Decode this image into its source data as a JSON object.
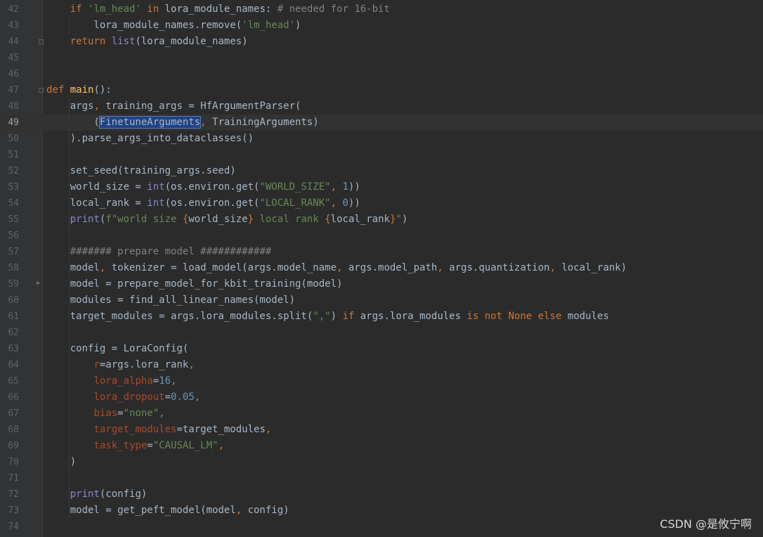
{
  "lines": [
    {
      "n": "42",
      "segs": [
        [
          "    ",
          ""
        ],
        [
          "if ",
          "kw"
        ],
        [
          "'lm_head'",
          "str"
        ],
        [
          " in ",
          "kw"
        ],
        [
          "lora_module_names: ",
          ""
        ],
        [
          "# needed for 16-bit",
          "com"
        ]
      ]
    },
    {
      "n": "43",
      "segs": [
        [
          "        lora_module_names.remove(",
          ""
        ],
        [
          "'lm_head'",
          "str"
        ],
        [
          ")",
          ""
        ]
      ]
    },
    {
      "n": "44",
      "segs": [
        [
          "    ",
          ""
        ],
        [
          "return ",
          "kw"
        ],
        [
          "list",
          "bi"
        ],
        [
          "(lora_module_names)",
          ""
        ]
      ]
    },
    {
      "n": "45",
      "segs": []
    },
    {
      "n": "46",
      "segs": []
    },
    {
      "n": "47",
      "segs": [
        [
          "def ",
          "kw"
        ],
        [
          "main",
          "fn"
        ],
        [
          "():",
          ""
        ]
      ]
    },
    {
      "n": "48",
      "segs": [
        [
          "    args",
          ""
        ],
        [
          ", ",
          "kw"
        ],
        [
          "training_args = HfArgumentParser(",
          ""
        ]
      ]
    },
    {
      "n": "49",
      "current": true,
      "segs": [
        [
          "        (",
          ""
        ],
        [
          "FinetuneArguments",
          "sel"
        ],
        [
          ", ",
          "kw"
        ],
        [
          "TrainingArguments)",
          ""
        ]
      ]
    },
    {
      "n": "50",
      "segs": [
        [
          "    ).parse_args_into_dataclasses()",
          ""
        ]
      ]
    },
    {
      "n": "51",
      "segs": []
    },
    {
      "n": "52",
      "segs": [
        [
          "    set_seed(training_args.seed)",
          ""
        ]
      ]
    },
    {
      "n": "53",
      "segs": [
        [
          "    world_size = ",
          ""
        ],
        [
          "int",
          "bi"
        ],
        [
          "(os.environ.get(",
          ""
        ],
        [
          "\"WORLD_SIZE\"",
          "str"
        ],
        [
          ", ",
          "kw"
        ],
        [
          "1",
          "num"
        ],
        [
          "))",
          ""
        ]
      ]
    },
    {
      "n": "54",
      "segs": [
        [
          "    local_rank = ",
          ""
        ],
        [
          "int",
          "bi"
        ],
        [
          "(os.environ.get(",
          ""
        ],
        [
          "\"LOCAL_RANK\"",
          "str"
        ],
        [
          ", ",
          "kw"
        ],
        [
          "0",
          "num"
        ],
        [
          "))",
          ""
        ]
      ]
    },
    {
      "n": "55",
      "segs": [
        [
          "    ",
          ""
        ],
        [
          "print",
          "bi"
        ],
        [
          "(",
          ""
        ],
        [
          "f\"world size ",
          "str"
        ],
        [
          "{",
          "kw"
        ],
        [
          "world_size",
          ""
        ],
        [
          "}",
          "kw"
        ],
        [
          " local rank ",
          "str"
        ],
        [
          "{",
          "kw"
        ],
        [
          "local_rank",
          ""
        ],
        [
          "}",
          "kw"
        ],
        [
          "\"",
          "str"
        ],
        [
          ")",
          ""
        ]
      ]
    },
    {
      "n": "56",
      "segs": []
    },
    {
      "n": "57",
      "segs": [
        [
          "    ",
          ""
        ],
        [
          "####### prepare model ############",
          "com"
        ]
      ]
    },
    {
      "n": "58",
      "segs": [
        [
          "    model",
          ""
        ],
        [
          ", ",
          "kw"
        ],
        [
          "tokenizer = load_model(args.model_name",
          ""
        ],
        [
          ", ",
          "kw"
        ],
        [
          "args.model_path",
          ""
        ],
        [
          ", ",
          "kw"
        ],
        [
          "args.quantization",
          ""
        ],
        [
          ", ",
          "kw"
        ],
        [
          "local_rank)",
          ""
        ]
      ]
    },
    {
      "n": "59",
      "segs": [
        [
          "    model = prepare_model_for_kbit_training(model)",
          ""
        ]
      ]
    },
    {
      "n": "60",
      "segs": [
        [
          "    modules = find_all_linear_names(model)",
          ""
        ]
      ]
    },
    {
      "n": "61",
      "segs": [
        [
          "    target_modules = args.lora_modules.split(",
          ""
        ],
        [
          "\",\"",
          "str"
        ],
        [
          ") ",
          ""
        ],
        [
          "if ",
          "kw"
        ],
        [
          "args.lora_modules ",
          ""
        ],
        [
          "is not None else ",
          "kw"
        ],
        [
          "modules",
          ""
        ]
      ]
    },
    {
      "n": "62",
      "segs": []
    },
    {
      "n": "63",
      "segs": [
        [
          "    config = LoraConfig(",
          ""
        ]
      ]
    },
    {
      "n": "64",
      "segs": [
        [
          "        ",
          ""
        ],
        [
          "r",
          "param"
        ],
        [
          "=args.lora_rank",
          ""
        ],
        [
          ",",
          "kw"
        ]
      ]
    },
    {
      "n": "65",
      "segs": [
        [
          "        ",
          ""
        ],
        [
          "lora_alpha",
          "param"
        ],
        [
          "=",
          ""
        ],
        [
          "16",
          "num"
        ],
        [
          ",",
          "kw"
        ]
      ]
    },
    {
      "n": "66",
      "segs": [
        [
          "        ",
          ""
        ],
        [
          "lora_dropout",
          "param"
        ],
        [
          "=",
          ""
        ],
        [
          "0.05",
          "num"
        ],
        [
          ",",
          "kw"
        ]
      ]
    },
    {
      "n": "67",
      "segs": [
        [
          "        ",
          ""
        ],
        [
          "bias",
          "param"
        ],
        [
          "=",
          ""
        ],
        [
          "\"none\"",
          "str"
        ],
        [
          ",",
          "kw"
        ]
      ]
    },
    {
      "n": "68",
      "segs": [
        [
          "        ",
          ""
        ],
        [
          "target_modules",
          "param"
        ],
        [
          "=target_modules",
          ""
        ],
        [
          ",",
          "kw"
        ]
      ]
    },
    {
      "n": "69",
      "segs": [
        [
          "        ",
          ""
        ],
        [
          "task_type",
          "param"
        ],
        [
          "=",
          ""
        ],
        [
          "\"CAUSAL_LM\"",
          "str"
        ],
        [
          ",",
          "kw"
        ]
      ]
    },
    {
      "n": "70",
      "segs": [
        [
          "    )",
          ""
        ]
      ]
    },
    {
      "n": "71",
      "segs": []
    },
    {
      "n": "72",
      "segs": [
        [
          "    ",
          ""
        ],
        [
          "print",
          "bi"
        ],
        [
          "(config)",
          ""
        ]
      ]
    },
    {
      "n": "73",
      "segs": [
        [
          "    model = get_peft_model(model",
          ""
        ],
        [
          ", ",
          "kw"
        ],
        [
          "config)",
          ""
        ]
      ]
    },
    {
      "n": "74",
      "segs": []
    }
  ],
  "colors": {
    "background": "#2b2b2b",
    "keyword": "#cc7832",
    "string": "#6a8759",
    "number": "#6897bb",
    "comment": "#808080",
    "function": "#ffc66d",
    "builtin": "#8888c6",
    "parameter": "#aa4926",
    "selection": "#214283"
  },
  "watermark": "CSDN @是攸宁啊"
}
